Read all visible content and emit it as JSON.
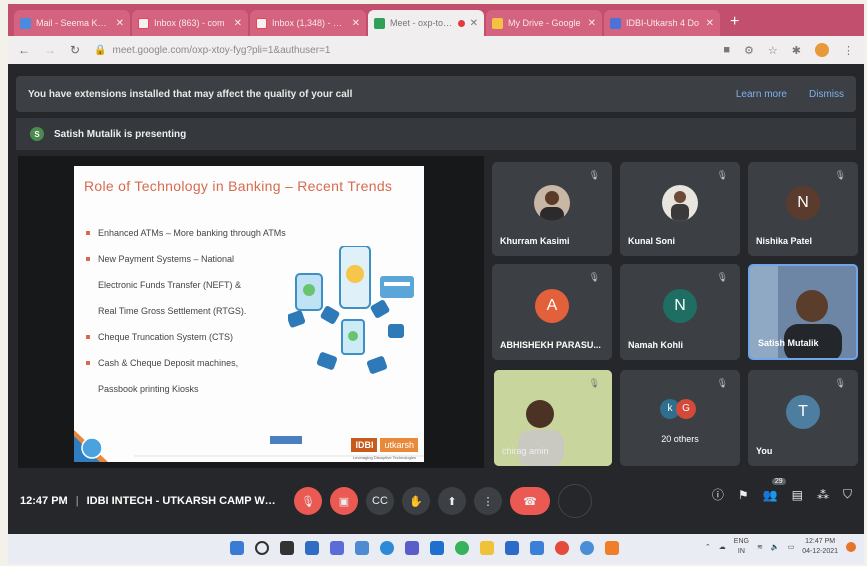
{
  "browser": {
    "tabs": [
      {
        "title": "Mail - Seema Khan",
        "color": "#4a8be0"
      },
      {
        "title": "Inbox (863) - com",
        "color": "#f2f2f2"
      },
      {
        "title": "Inbox (1,348) - bus",
        "color": "#f2f2f2"
      },
      {
        "title": "Meet - oxp-toy-fyg",
        "color": "#2f9f5a",
        "active": true
      },
      {
        "title": "My Drive - Google",
        "color": "#f3c242"
      },
      {
        "title": "IDBI-Utkarsh 4 Do",
        "color": "#4a72d8"
      }
    ],
    "new_tab": "+",
    "url": "meet.google.com/oxp-xtoy-fyg?pli=1&authuser=1"
  },
  "notice": {
    "text": "You have extensions installed that may affect the quality of your call",
    "learn_more": "Learn more",
    "dismiss": "Dismiss"
  },
  "presenting": {
    "avatar_letter": "S",
    "text": "Satish Mutalik is presenting"
  },
  "slide": {
    "title": "Role of Technology in Banking – Recent Trends",
    "bullets": [
      {
        "text": "Enhanced ATMs – More banking through ATMs",
        "bullet": true
      },
      {
        "text": "New Payment Systems – National",
        "bullet": true
      },
      {
        "text": "Electronic Funds Transfer (NEFT) &",
        "bullet": false
      },
      {
        "text": "Real Time Gross Settlement (RTGS).",
        "bullet": false
      },
      {
        "text": "Cheque Truncation System (CTS)",
        "bullet": true
      },
      {
        "text": "Cash & Cheque Deposit machines,",
        "bullet": true
      },
      {
        "text": "Passbook printing Kiosks",
        "bullet": false
      }
    ],
    "logo": "IDBI",
    "logo_tag": "utkarsh",
    "logo_sub": "Leveraging Disruptive Technologies"
  },
  "participants": [
    {
      "name": "Khurram Kasimi",
      "type": "photo"
    },
    {
      "name": "Kunal Soni",
      "type": "photo"
    },
    {
      "name": "Nishika Patel",
      "type": "letter",
      "letter": "N",
      "color": "#5b3b2e"
    },
    {
      "name": "ABHISHEKH PARASU...",
      "type": "letter",
      "letter": "A",
      "color": "#e3613a"
    },
    {
      "name": "Namah Kohli",
      "type": "letter",
      "letter": "N",
      "color": "#1f6e63"
    },
    {
      "name": "Satish Mutalik",
      "type": "video"
    },
    {
      "name": "chirag amin",
      "type": "video"
    },
    {
      "name": "20 others",
      "type": "others",
      "letters": [
        "k",
        "G"
      ]
    },
    {
      "name": "You",
      "type": "letter",
      "letter": "T",
      "color": "#4d7ea0"
    }
  ],
  "bottom": {
    "time": "12:47 PM",
    "separator": "|",
    "meeting": "IDBI INTECH - UTKARSH CAMP Wor...",
    "people_count": "29"
  },
  "taskbar": {
    "lang1": "ENG",
    "lang2": "IN",
    "time": "12:47 PM",
    "date": "04-12-2021"
  }
}
